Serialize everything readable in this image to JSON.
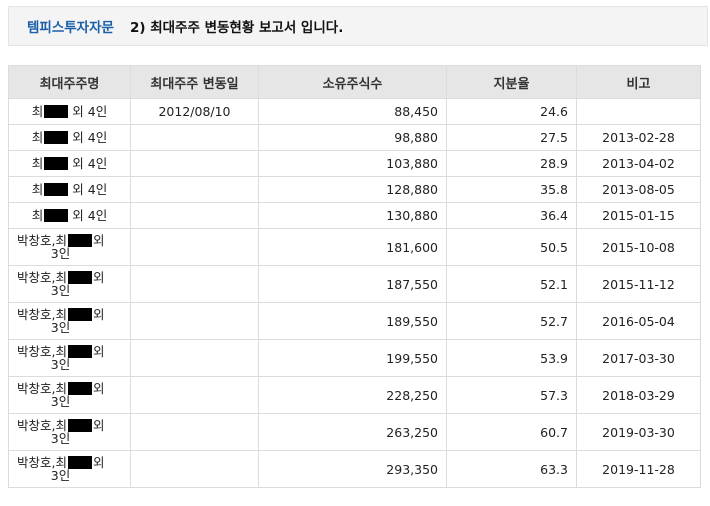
{
  "header": {
    "company": "템피스투자자문",
    "title": "2) 최대주주 변동현황 보고서 입니다."
  },
  "table": {
    "columns": [
      "최대주주명",
      "최대주주 변동일",
      "소유주식수",
      "지분율",
      "비고"
    ],
    "rows": [
      {
        "holder_prefix": "최",
        "holder_suffix": "외 4인",
        "date": "2012/08/10",
        "shares": "88,450",
        "ratio": "24.6",
        "note": ""
      },
      {
        "holder_prefix": "최",
        "holder_suffix": "외 4인",
        "date": "",
        "shares": "98,880",
        "ratio": "27.5",
        "note": "2013-02-28"
      },
      {
        "holder_prefix": "최",
        "holder_suffix": "외 4인",
        "date": "",
        "shares": "103,880",
        "ratio": "28.9",
        "note": "2013-04-02"
      },
      {
        "holder_prefix": "최",
        "holder_suffix": "외 4인",
        "date": "",
        "shares": "128,880",
        "ratio": "35.8",
        "note": "2013-08-05"
      },
      {
        "holder_prefix": "최",
        "holder_suffix": "외 4인",
        "date": "",
        "shares": "130,880",
        "ratio": "36.4",
        "note": "2015-01-15"
      },
      {
        "holder_prefix": "박창호,최",
        "holder_suffix": "외",
        "holder_line2": "3인",
        "date": "",
        "shares": "181,600",
        "ratio": "50.5",
        "note": "2015-10-08"
      },
      {
        "holder_prefix": "박창호,최",
        "holder_suffix": "외",
        "holder_line2": "3인",
        "date": "",
        "shares": "187,550",
        "ratio": "52.1",
        "note": "2015-11-12"
      },
      {
        "holder_prefix": "박창호,최",
        "holder_suffix": "외",
        "holder_line2": "3인",
        "date": "",
        "shares": "189,550",
        "ratio": "52.7",
        "note": "2016-05-04"
      },
      {
        "holder_prefix": "박창호,최",
        "holder_suffix": "외",
        "holder_line2": "3인",
        "date": "",
        "shares": "199,550",
        "ratio": "53.9",
        "note": "2017-03-30"
      },
      {
        "holder_prefix": "박창호,최",
        "holder_suffix": "외",
        "holder_line2": "3인",
        "date": "",
        "shares": "228,250",
        "ratio": "57.3",
        "note": "2018-03-29"
      },
      {
        "holder_prefix": "박창호,최",
        "holder_suffix": "외",
        "holder_line2": "3인",
        "date": "",
        "shares": "263,250",
        "ratio": "60.7",
        "note": "2019-03-30"
      },
      {
        "holder_prefix": "박창호,최",
        "holder_suffix": "외",
        "holder_line2": "3인",
        "date": "",
        "shares": "293,350",
        "ratio": "63.3",
        "note": "2019-11-28"
      }
    ]
  }
}
